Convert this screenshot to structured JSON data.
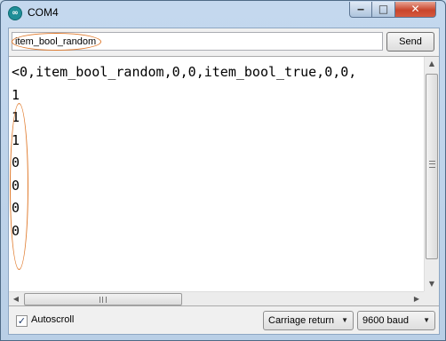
{
  "window": {
    "title": "COM4",
    "buttons": {
      "minimize": "‒",
      "maximize": "□",
      "close": "✕"
    }
  },
  "send_bar": {
    "input_value": "item_bool_random",
    "send_label": "Send"
  },
  "output": {
    "lines": [
      "<0,item_bool_random,0,0,item_bool_true,0,0,",
      "1",
      "1",
      "1",
      "0",
      "0",
      "0",
      "0"
    ]
  },
  "bottom_bar": {
    "autoscroll_label": "Autoscroll",
    "autoscroll_checked": true,
    "line_ending": "Carriage return",
    "baud_rate": "9600 baud"
  },
  "colors": {
    "highlight": "#e07a2c",
    "window_frame": "#c4d8ee",
    "close_button": "#c9452c"
  }
}
